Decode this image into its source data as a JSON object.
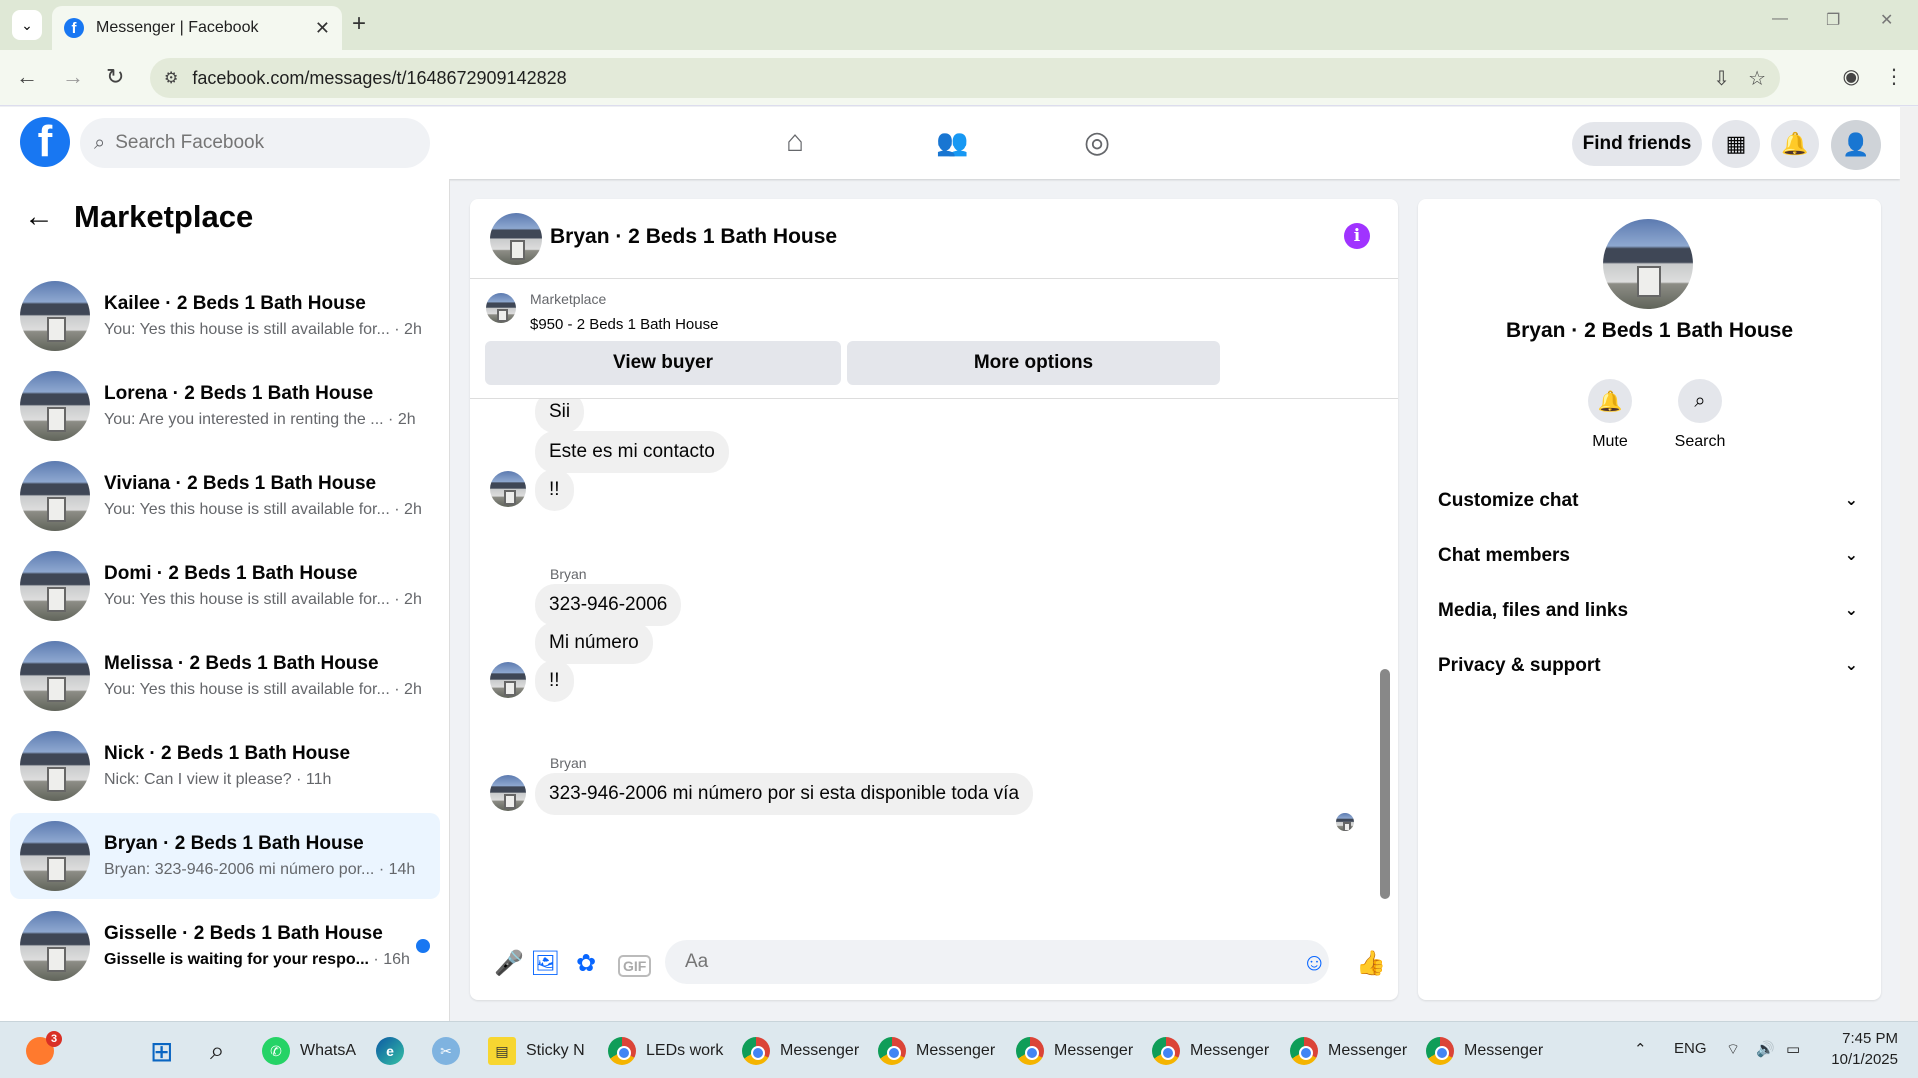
{
  "browser": {
    "tab_title": "Messenger | Facebook",
    "url": "facebook.com/messages/t/1648672909142828"
  },
  "fb": {
    "search_placeholder": "Search Facebook",
    "find_friends": "Find friends"
  },
  "left": {
    "title": "Marketplace",
    "conversations": [
      {
        "name": "Kailee · 2 Beds 1 Bath House",
        "preview": "You: Yes this house is still available for...",
        "time": "· 2h",
        "unread": false
      },
      {
        "name": "Lorena · 2 Beds 1 Bath House",
        "preview": "You: Are you interested in renting the ...",
        "time": "· 2h",
        "unread": false
      },
      {
        "name": "Viviana · 2 Beds 1 Bath House",
        "preview": "You: Yes this house is still available for...",
        "time": "· 2h",
        "unread": false
      },
      {
        "name": "Domi · 2 Beds 1 Bath House",
        "preview": "You: Yes this house is still available for...",
        "time": "· 2h",
        "unread": false
      },
      {
        "name": "Melissa · 2 Beds 1 Bath House",
        "preview": "You: Yes this house is still available for...",
        "time": "· 2h",
        "unread": false
      },
      {
        "name": "Nick · 2 Beds 1 Bath House",
        "preview": "Nick: Can I view it please?",
        "time": "· 11h",
        "unread": false
      },
      {
        "name": "Bryan · 2 Beds 1 Bath House",
        "preview": "Bryan: 323-946-2006 mi número por...",
        "time": "· 14h",
        "unread": false
      },
      {
        "name": "Gisselle · 2 Beds 1 Bath House",
        "preview": "Gisselle is waiting for your respo...",
        "time": "· 16h",
        "unread": true
      }
    ]
  },
  "chat": {
    "title": "Bryan · 2 Beds 1 Bath House",
    "marketplace_label": "Marketplace",
    "listing": "$950 - 2 Beds 1 Bath House",
    "view_buyer": "View buyer",
    "more_options": "More options",
    "messages": [
      {
        "sender": "",
        "text": "Sii"
      },
      {
        "sender": "",
        "text": "Este es mi contacto"
      },
      {
        "sender": "",
        "text": "!!"
      },
      {
        "sender": "Bryan",
        "text": "323-946-2006"
      },
      {
        "sender": "",
        "text": "Mi número"
      },
      {
        "sender": "",
        "text": "!!"
      },
      {
        "sender": "Bryan",
        "text": "323-946-2006 mi número por si esta disponible toda vía"
      }
    ],
    "input_placeholder": "Aa",
    "gif_label": "GIF"
  },
  "info": {
    "name": "Bryan · 2 Beds 1 Bath House",
    "mute": "Mute",
    "search": "Search",
    "sections": [
      "Customize chat",
      "Chat members",
      "Media, files and links",
      "Privacy & support"
    ]
  },
  "taskbar": {
    "badge": "3",
    "items": [
      "WhatsA",
      "Sticky N",
      "LEDs work",
      "Messenger",
      "Messenger",
      "Messenger",
      "Messenger",
      "Messenger",
      "Messenger"
    ],
    "lang": "ENG",
    "time": "7:45 PM",
    "date": "10/1/2025"
  },
  "colors": {
    "brand": "#1877f2",
    "active_row": "#ebf5ff",
    "info": "#a033ff"
  }
}
